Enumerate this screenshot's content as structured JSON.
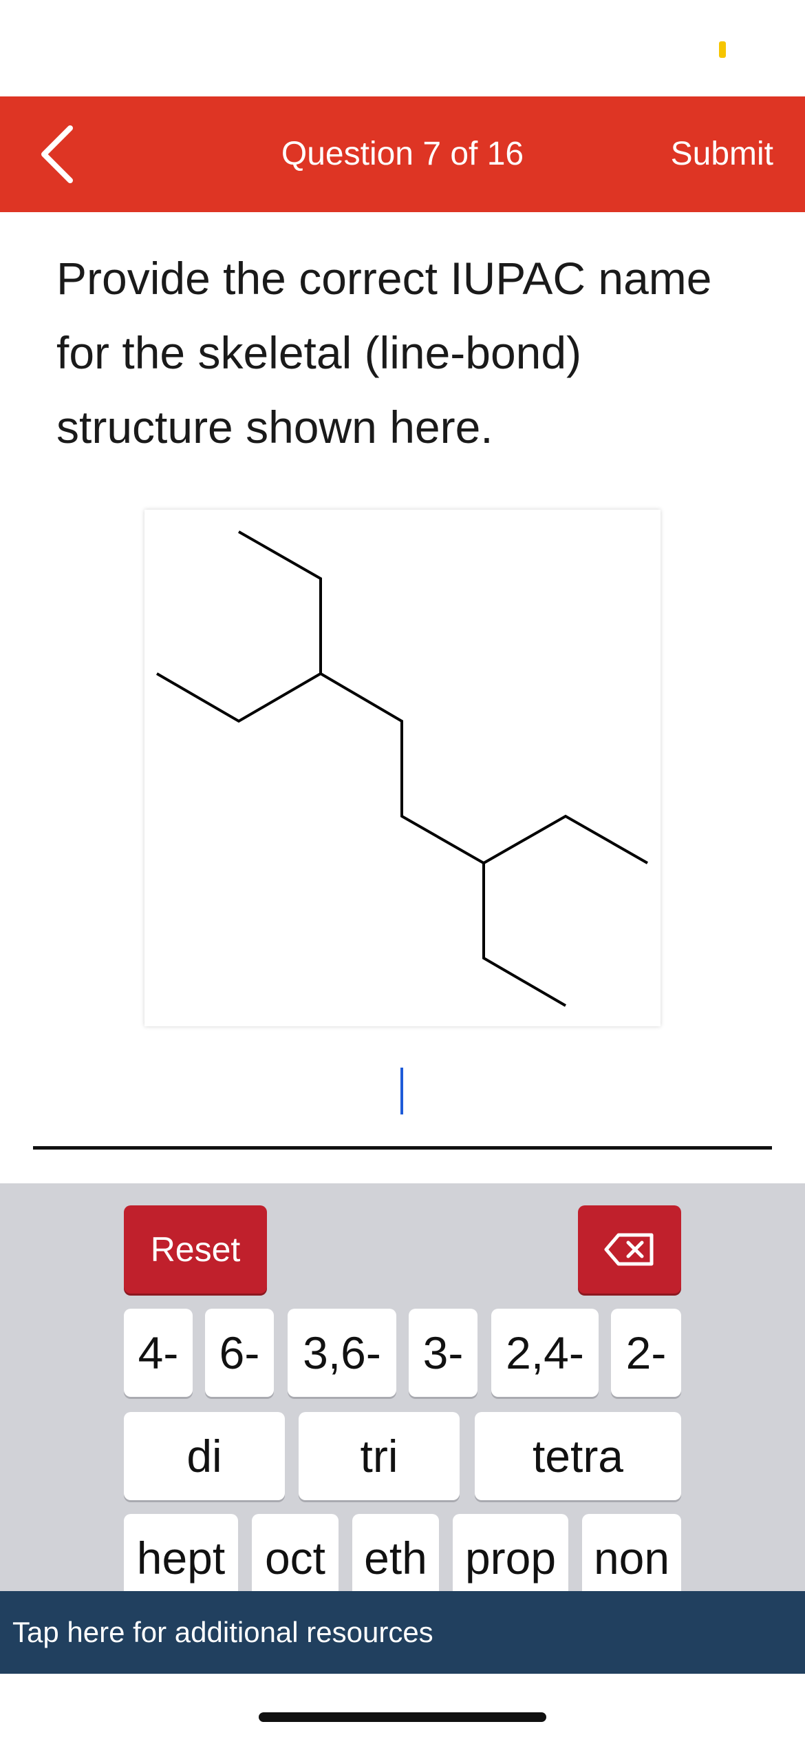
{
  "header": {
    "title": "Question 7 of 16",
    "submit_label": "Submit"
  },
  "question": {
    "text": "Provide the correct IUPAC name for the skeletal (line-bond) structure shown here."
  },
  "answer": {
    "value": ""
  },
  "keyboard": {
    "reset_label": "Reset",
    "row1": [
      "4-",
      "6-",
      "3,6-",
      "3-",
      "2,4-",
      "2-"
    ],
    "row2": [
      "di",
      "tri",
      "tetra"
    ],
    "row3": [
      "hept",
      "oct",
      "eth",
      "prop",
      "non"
    ]
  },
  "footer": {
    "resources_label": "Tap here for additional resources"
  },
  "colors": {
    "header": "#de3524",
    "key_red": "#c0202c",
    "footer": "#21405f",
    "keyboard_bg": "#d1d2d7"
  }
}
